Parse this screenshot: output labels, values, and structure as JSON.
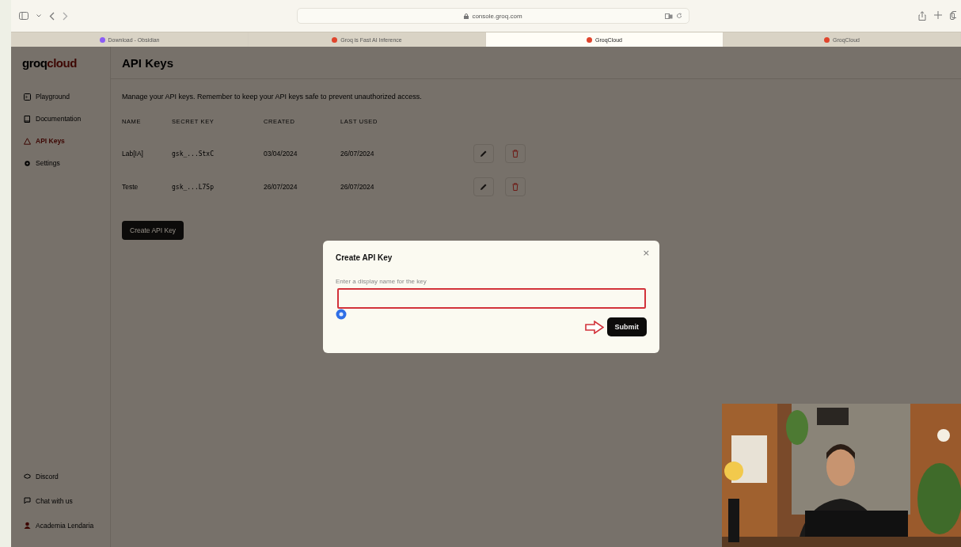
{
  "browser": {
    "address": "console.groq.com",
    "tabs": [
      {
        "title": "Download - Obsidian",
        "selected": false,
        "color": "#8b5cf6"
      },
      {
        "title": "Groq is Fast AI Inference",
        "selected": false,
        "color": "#e0442c"
      },
      {
        "title": "GroqCloud",
        "selected": true,
        "color": "#e0442c"
      },
      {
        "title": "GroqCloud",
        "selected": false,
        "color": "#e0442c"
      }
    ]
  },
  "sidebar": {
    "logo": "groq",
    "logo_accent": "cloud",
    "items": [
      {
        "label": "Playground",
        "selected": false
      },
      {
        "label": "Documentation",
        "selected": false
      },
      {
        "label": "API Keys",
        "selected": true
      },
      {
        "label": "Settings",
        "selected": false
      }
    ],
    "footer": [
      {
        "label": "Discord"
      },
      {
        "label": "Chat with us"
      },
      {
        "label": "Academia Lendaria"
      }
    ]
  },
  "page": {
    "title": "API Keys",
    "description": "Manage your API keys. Remember to keep your API keys safe to prevent unauthorized access.",
    "columns": [
      "NAME",
      "SECRET KEY",
      "CREATED",
      "LAST USED"
    ],
    "rows": [
      [
        "Lab[IA]",
        "gsk_...StxC",
        "03/04/2024",
        "26/07/2024"
      ],
      [
        "Teste",
        "gsk_...L7Sp",
        "26/07/2024",
        "26/07/2024"
      ]
    ],
    "create_button": "Create API Key"
  },
  "modal": {
    "title": "Create API Key",
    "close": "×",
    "label": "Enter a display name for the key",
    "submit": "Submit"
  }
}
